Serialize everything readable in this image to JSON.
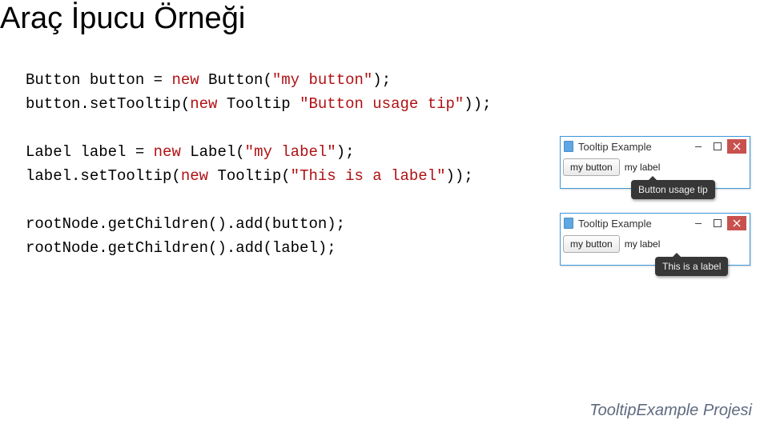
{
  "title": "Araç İpucu Örneği",
  "code": {
    "l1a": "Button button = ",
    "l1b": "new ",
    "l1c": "Button(",
    "l1d": "\"my button\"",
    "l1e": ");",
    "l2a": "button.setTooltip(",
    "l2b": "new ",
    "l2c": "Tooltip ",
    "l2d": "\"Button usage tip\"",
    "l2e": "));",
    "l3a": "Label label = ",
    "l3b": "new ",
    "l3c": "Label(",
    "l3d": "\"my label\"",
    "l3e": ");",
    "l4a": "label.setTooltip(",
    "l4b": "new ",
    "l4c": "Tooltip(",
    "l4d": "\"This is a label\"",
    "l4e": "));",
    "l5": "rootNode.getChildren().add(button);",
    "l6": "rootNode.getChildren().add(label);"
  },
  "win": {
    "title": "Tooltip Example",
    "button_label": "my button",
    "label_text": "my label",
    "tooltip1": "Button usage tip",
    "tooltip2": "This is a label"
  },
  "footer": "TooltipExample Projesi"
}
